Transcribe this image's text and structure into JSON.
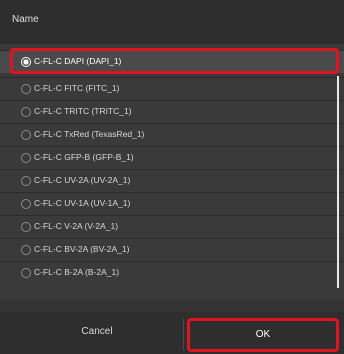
{
  "header": {
    "label": "Name"
  },
  "options": [
    {
      "label": "C-FL-C DAPI (DAPI_1)",
      "selected": true
    },
    {
      "label": "C-FL-C FITC (FITC_1)",
      "selected": false
    },
    {
      "label": "C-FL-C TRITC (TRITC_1)",
      "selected": false
    },
    {
      "label": "C-FL-C TxRed (TexasRed_1)",
      "selected": false
    },
    {
      "label": "C-FL-C GFP-B (GFP-B_1)",
      "selected": false
    },
    {
      "label": "C-FL-C UV-2A (UV-2A_1)",
      "selected": false
    },
    {
      "label": "C-FL-C UV-1A (UV-1A_1)",
      "selected": false
    },
    {
      "label": "C-FL-C V-2A (V-2A_1)",
      "selected": false
    },
    {
      "label": "C-FL-C BV-2A (BV-2A_1)",
      "selected": false
    },
    {
      "label": "C-FL-C B-2A (B-2A_1)",
      "selected": false
    }
  ],
  "footer": {
    "cancel_label": "Cancel",
    "ok_label": "OK"
  },
  "colors": {
    "highlight": "#e0141e",
    "background": "#333333"
  }
}
